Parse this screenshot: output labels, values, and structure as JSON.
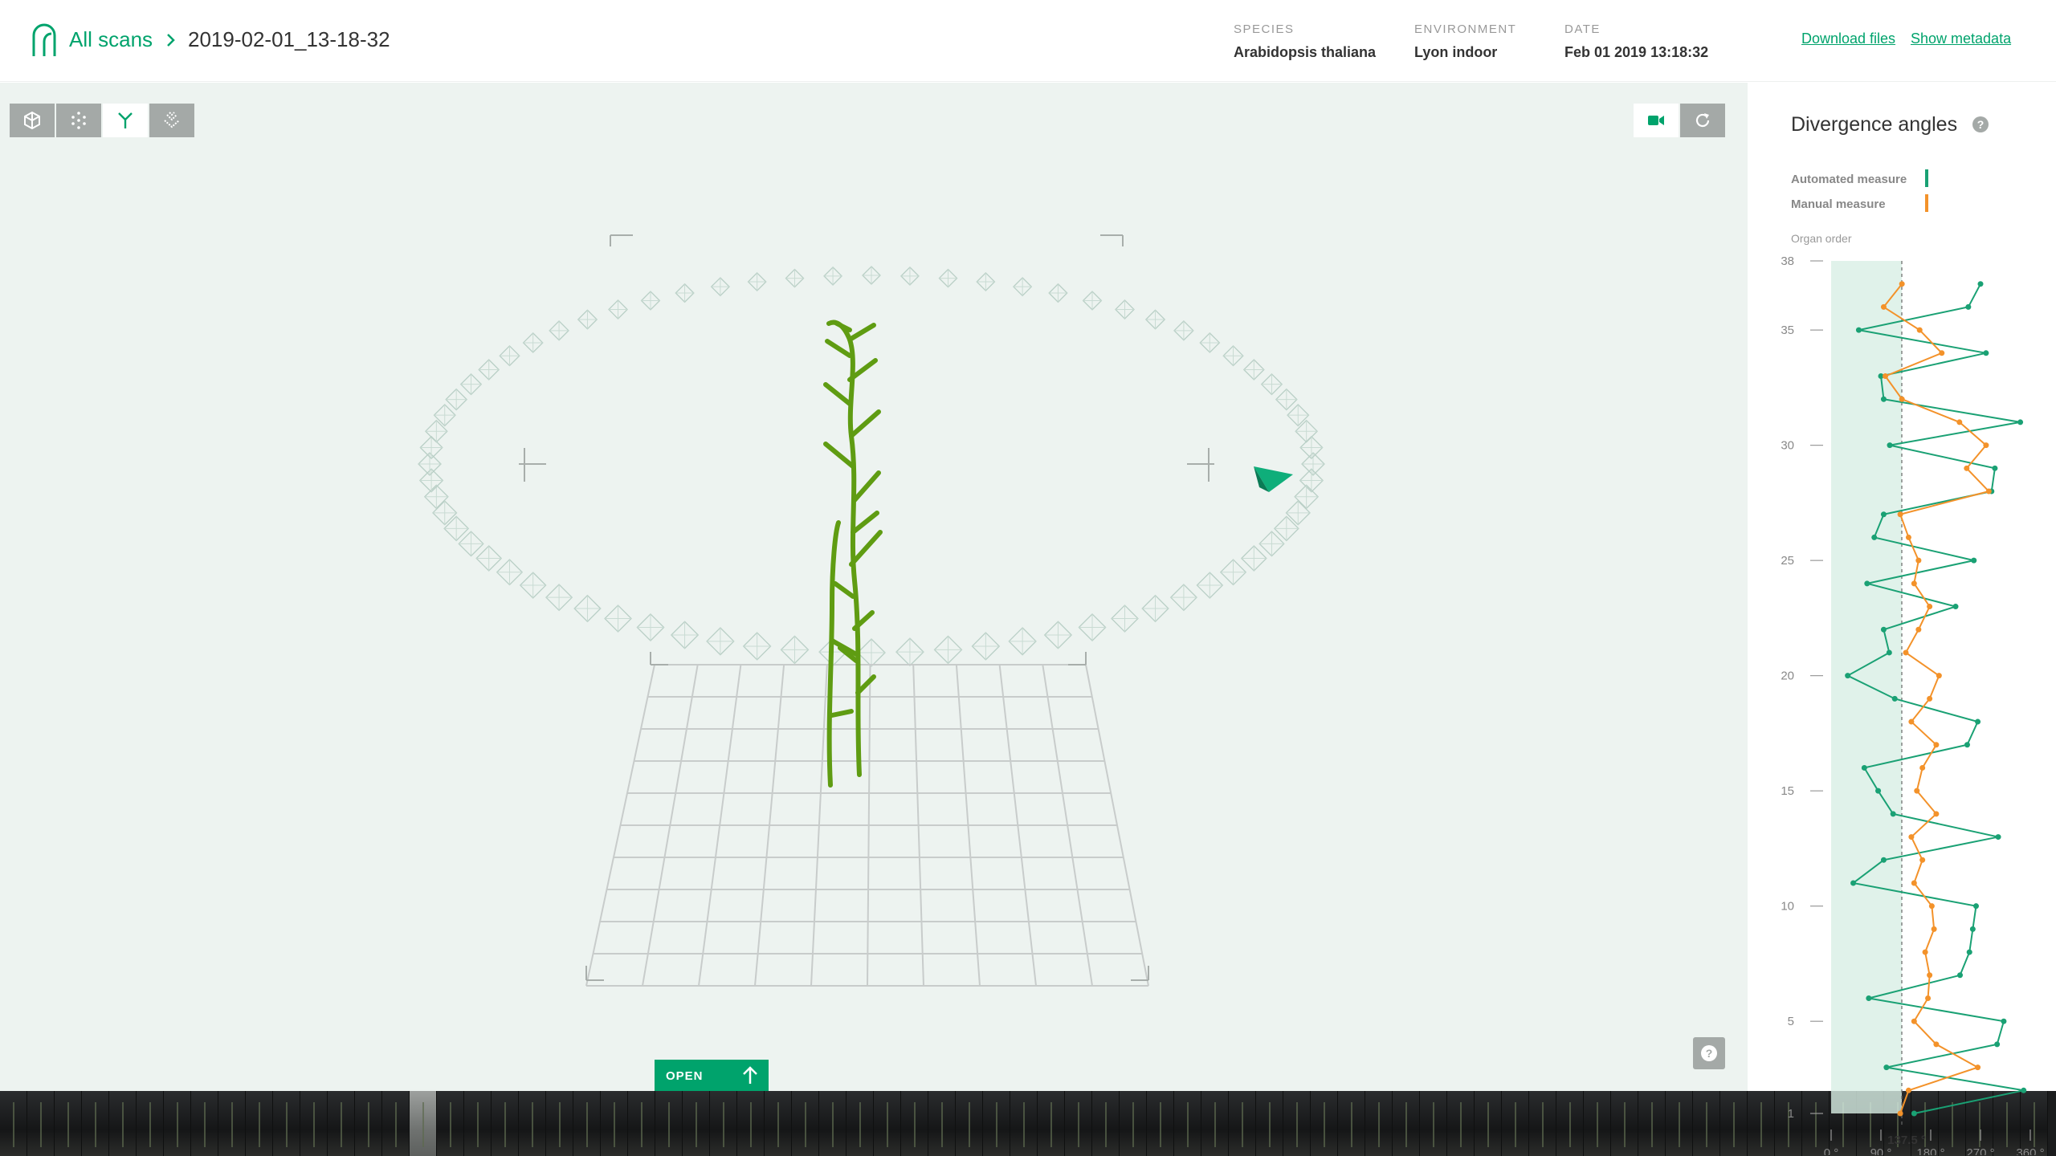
{
  "header": {
    "breadcrumb_root": "All scans",
    "breadcrumb_current": "2019-02-01_13-18-32",
    "species_label": "SPECIES",
    "species_value": "Arabidopsis thaliana",
    "environment_label": "ENVIRONMENT",
    "environment_value": "Lyon indoor",
    "date_label": "DATE",
    "date_value": "Feb 01 2019 13:18:32",
    "download_label": "Download files",
    "metadata_label": "Show metadata"
  },
  "viewer": {
    "tools": [
      {
        "icon": "mesh-icon",
        "active": false
      },
      {
        "icon": "point-cloud-icon",
        "active": false
      },
      {
        "icon": "skeleton-icon",
        "active": true
      },
      {
        "icon": "segmentation-icon",
        "active": false
      }
    ],
    "camera_buttons": [
      {
        "icon": "video-camera-icon",
        "active": true
      },
      {
        "icon": "reset-view-icon",
        "active": false
      }
    ],
    "open_label": "OPEN",
    "help_icon": "help-icon"
  },
  "filmstrip": {
    "frame_count": 75,
    "selected_index": 15
  },
  "panel": {
    "title": "Divergence angles",
    "legend_automated": "Automated measure",
    "legend_manual": "Manual measure",
    "axis_title": "Organ order",
    "colors": {
      "automated": "#1aa174",
      "manual": "#f3922a"
    }
  },
  "chart_data": {
    "type": "line",
    "title": "Divergence angles",
    "ylabel": "Organ order",
    "xlabel": "",
    "y_ticks": [
      1,
      5,
      10,
      15,
      20,
      25,
      30,
      35,
      38
    ],
    "x_ticks": [
      "0 °",
      "90 °",
      "180 °",
      "270 °",
      "360 °"
    ],
    "xlim": [
      0,
      360
    ],
    "ylim": [
      1,
      38
    ],
    "reference_label": "137.5 °",
    "reference_value": 137.5,
    "series": [
      {
        "name": "Automated measure",
        "color": "#1aa174",
        "organ": [
          1,
          2,
          3,
          4,
          5,
          6,
          7,
          8,
          9,
          10,
          11,
          12,
          13,
          14,
          15,
          16,
          17,
          18,
          19,
          20,
          21,
          22,
          23,
          24,
          25,
          26,
          27,
          28,
          29,
          30,
          31,
          32,
          33,
          34,
          35,
          36,
          37
        ],
        "values": [
          150,
          348,
          100,
          300,
          312,
          68,
          233,
          250,
          256,
          262,
          40,
          95,
          302,
          112,
          85,
          60,
          246,
          265,
          115,
          30,
          105,
          95,
          225,
          65,
          258,
          78,
          95,
          290,
          296,
          106,
          342,
          95,
          90,
          280,
          50,
          248,
          270
        ]
      },
      {
        "name": "Manual measure",
        "color": "#f3922a",
        "organ": [
          1,
          2,
          3,
          4,
          5,
          6,
          7,
          8,
          9,
          10,
          11,
          12,
          13,
          14,
          15,
          16,
          17,
          18,
          19,
          20,
          21,
          22,
          23,
          24,
          25,
          26,
          27,
          28,
          29,
          30,
          31,
          32,
          33,
          34,
          35,
          36,
          37
        ],
        "values": [
          125,
          140,
          265,
          190,
          150,
          175,
          178,
          170,
          186,
          182,
          150,
          165,
          145,
          190,
          155,
          165,
          190,
          145,
          178,
          195,
          135,
          158,
          178,
          150,
          158,
          140,
          125,
          285,
          245,
          280,
          232,
          128,
          98,
          200,
          160,
          95,
          128
        ]
      }
    ]
  }
}
